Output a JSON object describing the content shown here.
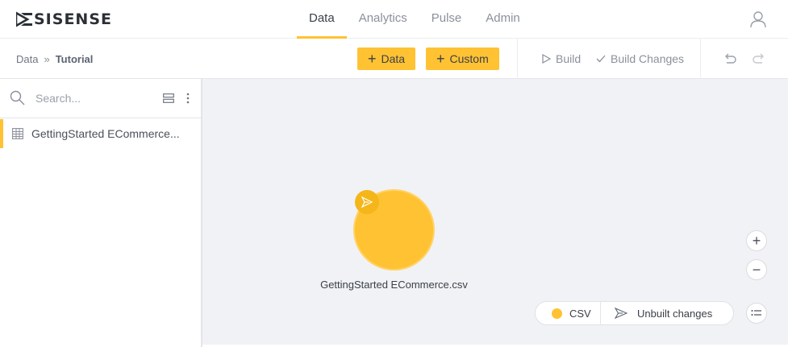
{
  "app": {
    "logo_text": "SISENSE"
  },
  "nav": {
    "tabs": [
      {
        "label": "Data",
        "active": true
      },
      {
        "label": "Analytics",
        "active": false
      },
      {
        "label": "Pulse",
        "active": false
      },
      {
        "label": "Admin",
        "active": false
      }
    ]
  },
  "breadcrumb": {
    "root": "Data",
    "separator": "»",
    "current": "Tutorial"
  },
  "toolbar": {
    "add_data_label": "Data",
    "add_custom_label": "Custom",
    "build_label": "Build",
    "build_changes_label": "Build Changes"
  },
  "sidebar": {
    "search_placeholder": "Search...",
    "datasets": [
      {
        "label": "GettingStarted ECommerce...",
        "icon": "table-icon",
        "selected": true
      }
    ]
  },
  "canvas": {
    "node": {
      "label": "GettingStarted ECommerce.csv",
      "color": "#ffc233",
      "badge_icon": "unbuilt-changes-icon"
    },
    "zoom_in": "+",
    "zoom_out": "−"
  },
  "legend": {
    "items": [
      {
        "label": "CSV",
        "color": "#ffc233"
      },
      {
        "label": "Unbuilt changes",
        "icon": "unbuilt-changes-icon"
      }
    ]
  },
  "colors": {
    "accent": "#ffc233",
    "canvas_bg": "#f1f2f5"
  }
}
